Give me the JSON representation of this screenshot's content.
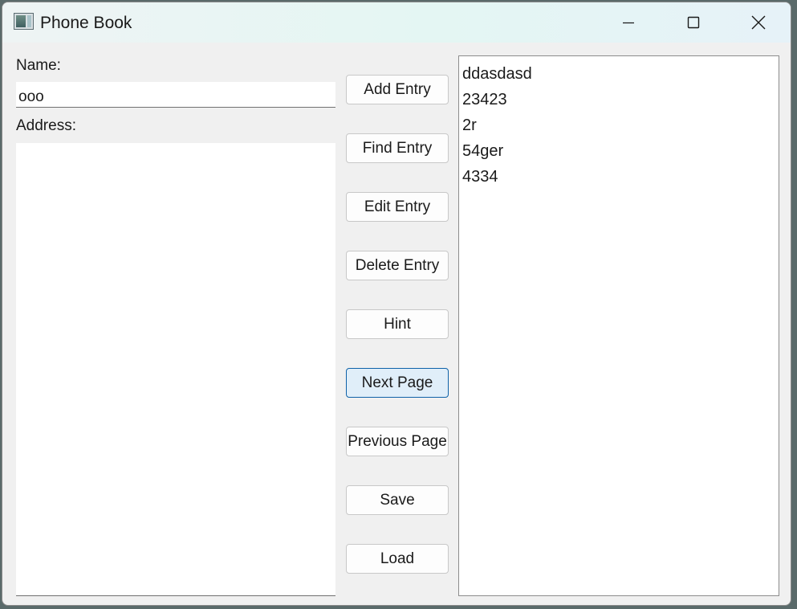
{
  "window": {
    "title": "Phone Book"
  },
  "title_controls": {
    "minimize_icon": "minimize-icon",
    "maximize_icon": "maximize-icon",
    "close_icon": "close-icon"
  },
  "form": {
    "name_label": "Name:",
    "name_value": "ooo",
    "address_label": "Address:",
    "address_value": ""
  },
  "buttons": {
    "add": "Add Entry",
    "find": "Find Entry",
    "edit": "Edit Entry",
    "delete": "Delete Entry",
    "hint": "Hint",
    "next": "Next Page",
    "previous": "Previous Page",
    "save": "Save",
    "load": "Load"
  },
  "list": {
    "items": [
      "ddasdasd",
      "23423",
      "2r",
      "54ger",
      "4334"
    ]
  },
  "colors": {
    "active_button_bg": "#e0eef9",
    "active_button_border": "#0f62a8"
  }
}
